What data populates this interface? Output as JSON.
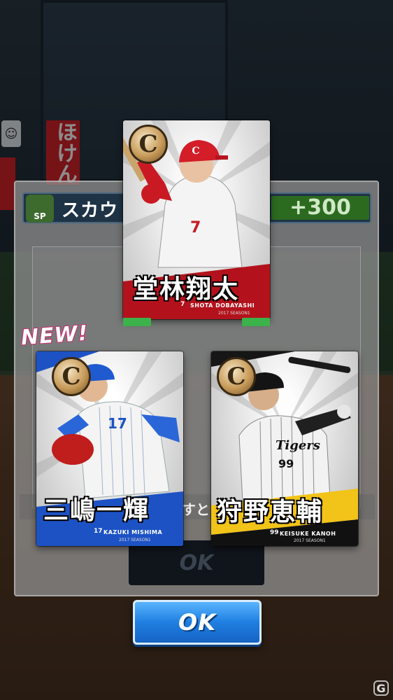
{
  "background": {
    "banner_text": "ほけん",
    "mascot_icon": "mascot-icon"
  },
  "dialog": {
    "sp_label": "SP",
    "scout_label": "スカウ",
    "scout_value": "+300",
    "description_fragment": "すと",
    "ok_label_dim": "OK"
  },
  "new_badge": "NEW!",
  "cards": [
    {
      "rank_letter": "C",
      "name": "堂林翔太",
      "romaji": "SHOTA DOBAYASHI",
      "number": "7",
      "season": "2017 SEASON1",
      "jersey_number": "7",
      "theme": "#b3121c"
    },
    {
      "rank_letter": "C",
      "name": "三嶋一輝",
      "romaji": "KAZUKI MISHIMA",
      "number": "17",
      "season": "2017 SEASON1",
      "jersey_number": "17",
      "theme": "#1c52c4"
    },
    {
      "rank_letter": "C",
      "name": "狩野恵輔",
      "romaji": "KEISUKE KANOH",
      "number": "99",
      "season": "2017 SEASON1",
      "jersey_text": "Tigers",
      "jersey_number": "99",
      "theme": "#f2c318"
    }
  ],
  "ok_button": "OK",
  "watermark": "G"
}
